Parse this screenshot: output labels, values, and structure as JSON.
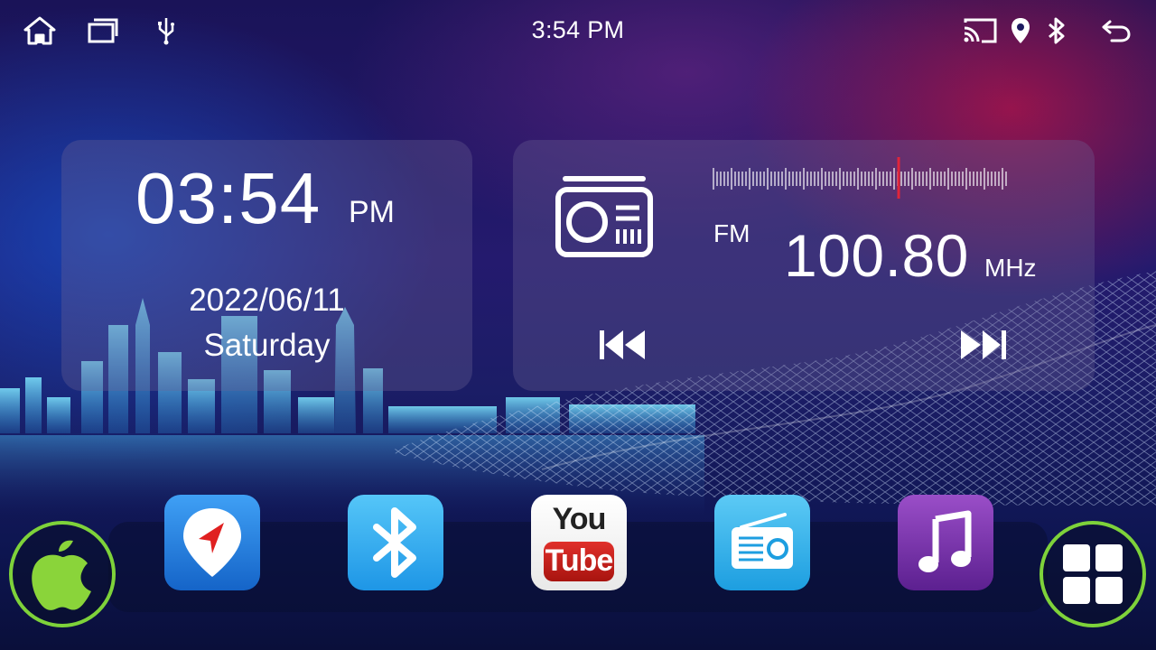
{
  "status_bar": {
    "time": "3:54 PM",
    "icons_left": [
      "home-icon",
      "recent-apps-icon",
      "usb-icon"
    ],
    "icons_right": [
      "screen-cast-icon",
      "location-icon",
      "bluetooth-icon",
      "back-icon"
    ]
  },
  "clock_widget": {
    "time": "03:54",
    "ampm": "PM",
    "date": "2022/06/11",
    "weekday": "Saturday"
  },
  "radio_widget": {
    "icon": "radio-icon",
    "band": "FM",
    "frequency": "100.80",
    "unit": "MHz",
    "controls": [
      "previous-track-icon",
      "next-track-icon"
    ],
    "indicator_color": "#e0253a"
  },
  "dock": {
    "left_button": {
      "icon": "carplay-apple-icon",
      "ring_color": "#7ed23a",
      "fill_color": "#8ad43a"
    },
    "apps": [
      {
        "name": "navigation",
        "icon": "navigation-icon",
        "color": "#1f7de0"
      },
      {
        "name": "bluetooth",
        "icon": "bluetooth-icon",
        "color": "#2aa7ee"
      },
      {
        "name": "youtube",
        "icon": "youtube-icon",
        "color": "#c2201c",
        "label_top": "You",
        "label_bottom": "Tube"
      },
      {
        "name": "radio",
        "icon": "radio-icon",
        "color": "#23aee6"
      },
      {
        "name": "music",
        "icon": "music-note-icon",
        "color": "#7b36b0"
      }
    ],
    "right_button": {
      "icon": "app-grid-icon",
      "ring_color": "#7ed23a"
    }
  }
}
